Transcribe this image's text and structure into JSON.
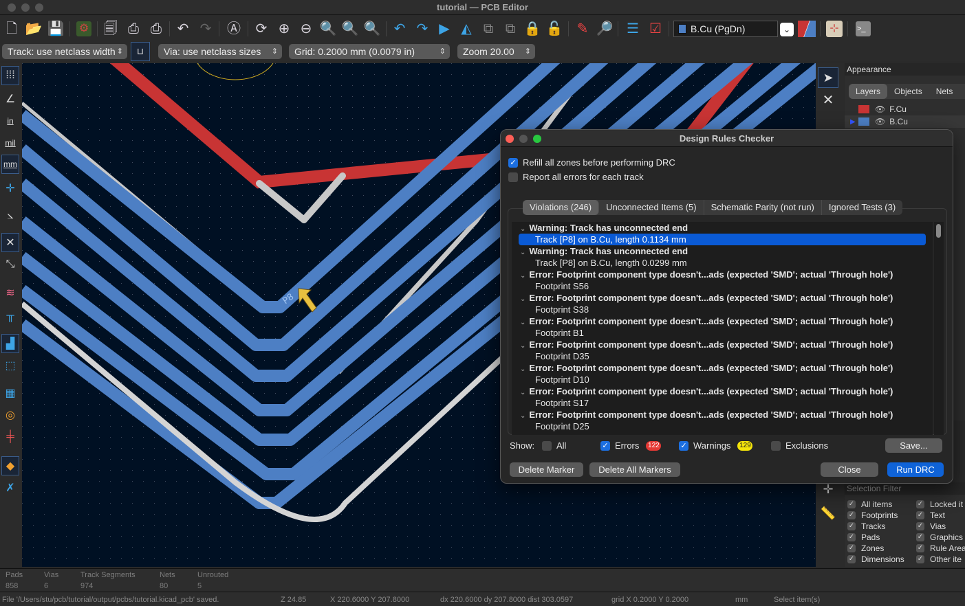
{
  "window": {
    "title": "tutorial — PCB Editor"
  },
  "toolbar": {
    "icons": [
      "new-board-icon",
      "open-icon",
      "save-icon",
      "board-setup-icon",
      "page-settings-icon",
      "print-icon",
      "plot-icon",
      "undo-icon",
      "redo-icon",
      "find-icon",
      "redraw-icon",
      "zoom-in-icon",
      "zoom-out-icon",
      "zoom-fit-icon",
      "zoom-objects-icon",
      "zoom-selection-icon",
      "rotate-ccw-icon",
      "rotate-cw-icon",
      "flip-icon",
      "mirror-icon",
      "group-icon",
      "ungroup-icon",
      "lock-icon",
      "unlock-icon",
      "update-pcb-icon",
      "footprint-browser-icon",
      "netlist-icon",
      "drc-icon"
    ],
    "active_layer": "B.Cu (PgDn)",
    "active_layer_color": "#4d7fc4"
  },
  "toolbar2": {
    "track_width": "Track: use netclass width",
    "via_size": "Via: use netclass sizes",
    "grid": "Grid: 0.2000 mm (0.0079 in)",
    "zoom": "Zoom 20.00"
  },
  "left_toolbar": {
    "icons": [
      "grid-icon",
      "polar-coords-icon",
      "inches-icon",
      "mils-icon",
      "millimeters-icon",
      "full-crosshair-icon",
      "angle-snap-icon",
      "ratsnest-icon",
      "curved-ratsnest-icon",
      "highlight-net-icon",
      "show-pads-icon",
      "fill-zones-icon",
      "outline-zones-icon",
      "track-outline-icon",
      "via-outline-icon",
      "pad-outline-icon",
      "layer-manager-icon",
      "properties-icon"
    ],
    "labels": {
      "in": "in",
      "mil": "mil",
      "mm": "mm"
    }
  },
  "canvas": {
    "net_label": "P8",
    "colors": {
      "background": "#001023",
      "front_copper": "#c83434",
      "back_copper": "#4d7fc4",
      "edge": "#d0d0d0"
    }
  },
  "appearance": {
    "title": "Appearance",
    "tabs": [
      "Layers",
      "Objects",
      "Nets"
    ],
    "active_tab": "Layers",
    "layers": [
      {
        "name": "F.Cu",
        "color": "#c83434"
      },
      {
        "name": "B.Cu",
        "color": "#4d7fc4",
        "active": true
      }
    ]
  },
  "selection_filter": {
    "title": "Selection Filter",
    "items": [
      {
        "label": "All items",
        "checked": true
      },
      {
        "label": "Locked it",
        "checked": true
      },
      {
        "label": "Footprints",
        "checked": true
      },
      {
        "label": "Text",
        "checked": true
      },
      {
        "label": "Tracks",
        "checked": true
      },
      {
        "label": "Vias",
        "checked": true
      },
      {
        "label": "Pads",
        "checked": true
      },
      {
        "label": "Graphics",
        "checked": true
      },
      {
        "label": "Zones",
        "checked": true
      },
      {
        "label": "Rule Area",
        "checked": true
      },
      {
        "label": "Dimensions",
        "checked": true
      },
      {
        "label": "Other ite",
        "checked": true
      }
    ]
  },
  "drc": {
    "title": "Design Rules Checker",
    "refill_zones": {
      "label": "Refill all zones before performing DRC",
      "checked": true
    },
    "report_all": {
      "label": "Report all errors for each track",
      "checked": false
    },
    "tabs": [
      {
        "label": "Violations (246)",
        "active": true
      },
      {
        "label": "Unconnected Items (5)"
      },
      {
        "label": "Schematic Parity (not run)"
      },
      {
        "label": "Ignored Tests (3)"
      }
    ],
    "violations": [
      {
        "heading": "Warning: Track has unconnected end",
        "item": "Track [P8] on B.Cu, length 0.1134 mm",
        "selected": true
      },
      {
        "heading": "Warning: Track has unconnected end",
        "item": "Track [P8] on B.Cu, length 0.0299 mm"
      },
      {
        "heading": "Error: Footprint component type doesn't...ads (expected 'SMD'; actual 'Through hole')",
        "item": "Footprint S56"
      },
      {
        "heading": "Error: Footprint component type doesn't...ads (expected 'SMD'; actual 'Through hole')",
        "item": "Footprint S38"
      },
      {
        "heading": "Error: Footprint component type doesn't...ads (expected 'SMD'; actual 'Through hole')",
        "item": "Footprint B1"
      },
      {
        "heading": "Error: Footprint component type doesn't...ads (expected 'SMD'; actual 'Through hole')",
        "item": "Footprint D35"
      },
      {
        "heading": "Error: Footprint component type doesn't...ads (expected 'SMD'; actual 'Through hole')",
        "item": "Footprint D10"
      },
      {
        "heading": "Error: Footprint component type doesn't...ads (expected 'SMD'; actual 'Through hole')",
        "item": "Footprint S17"
      },
      {
        "heading": "Error: Footprint component type doesn't...ads (expected 'SMD'; actual 'Through hole')",
        "item": "Footprint D25"
      }
    ],
    "show": {
      "label": "Show:",
      "all": {
        "label": "All",
        "checked": false
      },
      "errors": {
        "label": "Errors",
        "checked": true,
        "count": "122",
        "color": "#e53935"
      },
      "warnings": {
        "label": "Warnings",
        "checked": true,
        "count": "129",
        "color": "#f5e50a"
      },
      "exclusions": {
        "label": "Exclusions",
        "checked": false
      }
    },
    "buttons": {
      "save": "Save...",
      "delete_marker": "Delete Marker",
      "delete_all": "Delete All Markers",
      "close": "Close",
      "run": "Run DRC"
    }
  },
  "stats": [
    {
      "label": "Pads",
      "value": "858"
    },
    {
      "label": "Vias",
      "value": "6"
    },
    {
      "label": "Track Segments",
      "value": "974"
    },
    {
      "label": "Nets",
      "value": "80"
    },
    {
      "label": "Unrouted",
      "value": "5"
    }
  ],
  "status": {
    "message": "File '/Users/stu/pcb/tutorial/output/pcbs/tutorial.kicad_pcb' saved.",
    "zoom": "Z 24.85",
    "coords": "X 220.6000  Y 207.8000",
    "delta": "dx 220.6000  dy 207.8000  dist 303.0597",
    "grid": "grid X 0.2000  Y 0.2000",
    "units": "mm",
    "mode": "Select item(s)"
  }
}
